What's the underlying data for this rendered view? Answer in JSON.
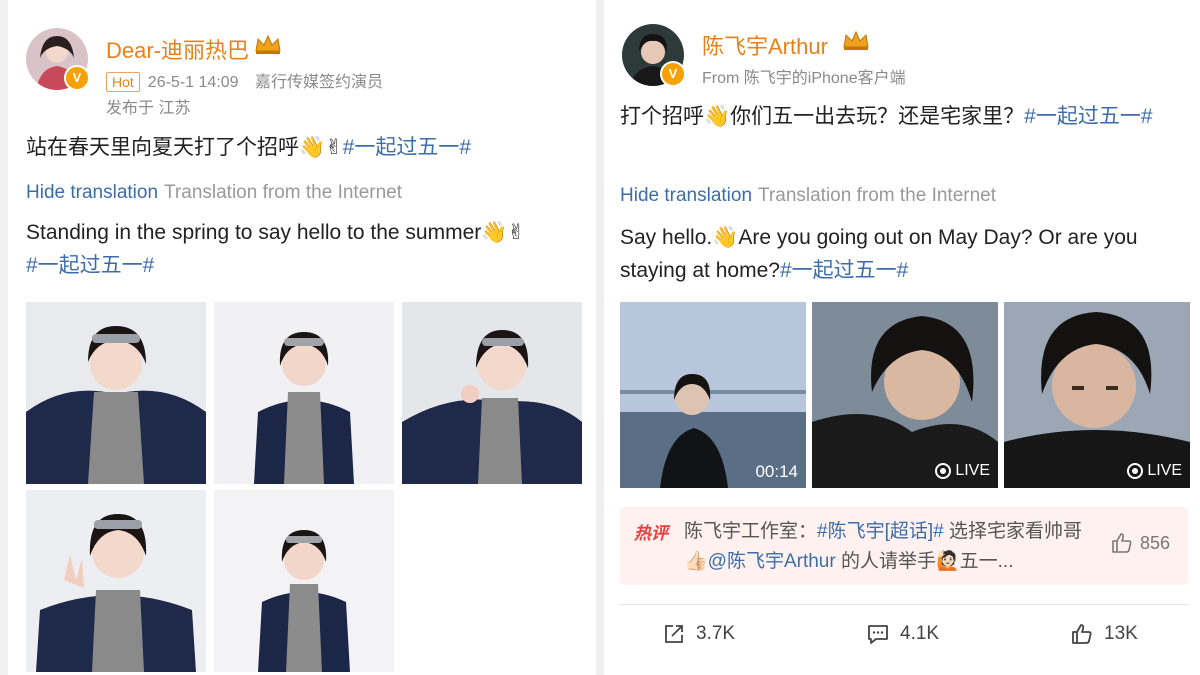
{
  "left_post": {
    "username": "Dear-迪丽热巴",
    "crown_icon": "crown-icon",
    "hot_badge": "Hot",
    "time": "26-5-1 14:09",
    "source": "嘉行传媒签约演员",
    "location": "发布于 江苏",
    "text_main": "站在春天里向夏天打了个招呼👋✌",
    "text_tag": "#一起过五一#",
    "hide_translation": "Hide translation",
    "translation_source": "Translation from the Internet",
    "translation_main": "Standing in the spring to say hello to the summer👋✌",
    "translation_tag": "#一起过五一#"
  },
  "right_post": {
    "username": "陈飞宇Arthur",
    "crown_icon": "crown-icon",
    "source": "From 陈飞宇的iPhone客户端",
    "text_main": "打个招呼👋你们五一出去玩？还是宅家里？",
    "text_tag": "#一起过五一#",
    "hide_translation": "Hide translation",
    "translation_source": "Translation from the Internet",
    "translation_main": "Say hello.👋Are you going out on May Day? Or are you staying at home?",
    "translation_tag": "#一起过五一#",
    "media": {
      "video_duration": "00:14",
      "live_label_1": "LIVE",
      "live_label_2": "LIVE"
    },
    "hot_comment": {
      "label": "热评",
      "author": "陈飞宇工作室：",
      "text_part1": "#陈飞宇[超话]#",
      "text_part2": " 选择宅家看帅哥👍🏻",
      "mention": "@陈飞宇Arthur",
      "text_part3": " 的人请举手🙋🏻五一...",
      "likes": "856"
    },
    "actions": {
      "share": "3.7K",
      "comment": "4.1K",
      "like": "13K"
    }
  },
  "colors": {
    "username": "#e8811a",
    "link": "#3d6da8",
    "hot_label": "#e84040"
  }
}
